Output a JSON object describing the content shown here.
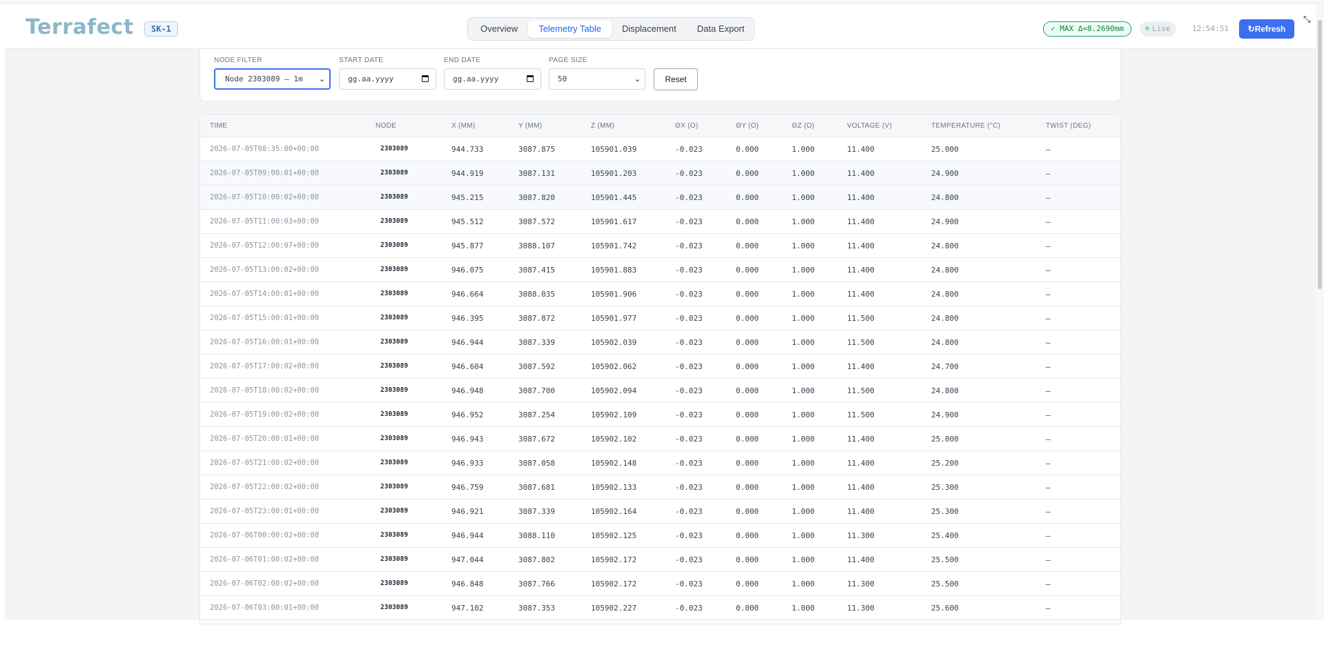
{
  "header": {
    "logo": "Terrafect",
    "site_badge": "SK-1",
    "tabs": [
      "Overview",
      "Telemetry Table",
      "Displacement",
      "Data Export"
    ],
    "active_tab": "Telemetry Table",
    "max_badge": "✓ MAX Δ=8.2690mm",
    "live": "Live",
    "clock": "12:54:51",
    "refresh_label": "Refresh",
    "refresh_icon": "↻"
  },
  "filters": {
    "node_label": "NODE FILTER",
    "node_value": "Node 2303089 — 1m",
    "start_label": "START DATE",
    "start_placeholder": "gg.aa.yyyy",
    "end_label": "END DATE",
    "end_placeholder": "gg.aa.yyyy",
    "page_size_label": "PAGE SIZE",
    "page_size_value": "50",
    "reset_label": "Reset"
  },
  "table": {
    "columns": [
      "TIME",
      "NODE",
      "X (MM)",
      "Y (MM)",
      "Z (MM)",
      "ΘX (Ο)",
      "ΘY (Ο)",
      "ΘZ (Ο)",
      "VOLTAGE (V)",
      "TEMPERATURE (°C)",
      "TWIST (DEG)"
    ],
    "rows": [
      [
        "2026-07-05T08:35:00+00:00",
        "2303089",
        "944.733",
        "3087.875",
        "105901.039",
        "-0.023",
        "0.000",
        "1.000",
        "11.400",
        "25.000",
        "—"
      ],
      [
        "2026-07-05T09:00:01+00:00",
        "2303089",
        "944.919",
        "3087.131",
        "105901.203",
        "-0.023",
        "0.000",
        "1.000",
        "11.400",
        "24.900",
        "—"
      ],
      [
        "2026-07-05T10:00:02+00:00",
        "2303089",
        "945.215",
        "3087.820",
        "105901.445",
        "-0.023",
        "0.000",
        "1.000",
        "11.400",
        "24.800",
        "—"
      ],
      [
        "2026-07-05T11:00:03+00:00",
        "2303089",
        "945.512",
        "3087.572",
        "105901.617",
        "-0.023",
        "0.000",
        "1.000",
        "11.400",
        "24.900",
        "—"
      ],
      [
        "2026-07-05T12:00:07+00:00",
        "2303089",
        "945.877",
        "3088.107",
        "105901.742",
        "-0.023",
        "0.000",
        "1.000",
        "11.400",
        "24.800",
        "—"
      ],
      [
        "2026-07-05T13:00:02+00:00",
        "2303089",
        "946.075",
        "3087.415",
        "105901.883",
        "-0.023",
        "0.000",
        "1.000",
        "11.400",
        "24.800",
        "—"
      ],
      [
        "2026-07-05T14:00:01+00:00",
        "2303089",
        "946.664",
        "3088.035",
        "105901.906",
        "-0.023",
        "0.000",
        "1.000",
        "11.400",
        "24.800",
        "—"
      ],
      [
        "2026-07-05T15:00:01+00:00",
        "2303089",
        "946.395",
        "3087.872",
        "105901.977",
        "-0.023",
        "0.000",
        "1.000",
        "11.500",
        "24.800",
        "—"
      ],
      [
        "2026-07-05T16:00:01+00:00",
        "2303089",
        "946.944",
        "3087.339",
        "105902.039",
        "-0.023",
        "0.000",
        "1.000",
        "11.500",
        "24.800",
        "—"
      ],
      [
        "2026-07-05T17:00:02+00:00",
        "2303089",
        "946.604",
        "3087.592",
        "105902.062",
        "-0.023",
        "0.000",
        "1.000",
        "11.400",
        "24.700",
        "—"
      ],
      [
        "2026-07-05T18:00:02+00:00",
        "2303089",
        "946.948",
        "3087.700",
        "105902.094",
        "-0.023",
        "0.000",
        "1.000",
        "11.500",
        "24.800",
        "—"
      ],
      [
        "2026-07-05T19:00:02+00:00",
        "2303089",
        "946.952",
        "3087.254",
        "105902.109",
        "-0.023",
        "0.000",
        "1.000",
        "11.500",
        "24.900",
        "—"
      ],
      [
        "2026-07-05T20:00:01+00:00",
        "2303089",
        "946.943",
        "3087.672",
        "105902.102",
        "-0.023",
        "0.000",
        "1.000",
        "11.400",
        "25.000",
        "—"
      ],
      [
        "2026-07-05T21:00:02+00:00",
        "2303089",
        "946.933",
        "3087.058",
        "105902.148",
        "-0.023",
        "0.000",
        "1.000",
        "11.400",
        "25.200",
        "—"
      ],
      [
        "2026-07-05T22:00:02+00:00",
        "2303089",
        "946.759",
        "3087.681",
        "105902.133",
        "-0.023",
        "0.000",
        "1.000",
        "11.400",
        "25.300",
        "—"
      ],
      [
        "2026-07-05T23:00:01+00:00",
        "2303089",
        "946.921",
        "3087.339",
        "105902.164",
        "-0.023",
        "0.000",
        "1.000",
        "11.400",
        "25.300",
        "—"
      ],
      [
        "2026-07-06T00:00:02+00:00",
        "2303089",
        "946.944",
        "3088.110",
        "105902.125",
        "-0.023",
        "0.000",
        "1.000",
        "11.300",
        "25.400",
        "—"
      ],
      [
        "2026-07-06T01:00:02+00:00",
        "2303089",
        "947.044",
        "3087.802",
        "105902.172",
        "-0.023",
        "0.000",
        "1.000",
        "11.400",
        "25.500",
        "—"
      ],
      [
        "2026-07-06T02:00:02+00:00",
        "2303089",
        "946.848",
        "3087.766",
        "105902.172",
        "-0.023",
        "0.000",
        "1.000",
        "11.300",
        "25.500",
        "—"
      ],
      [
        "2026-07-06T03:00:01+00:00",
        "2303089",
        "947.102",
        "3087.353",
        "105902.227",
        "-0.023",
        "0.000",
        "1.000",
        "11.300",
        "25.600",
        "—"
      ]
    ]
  }
}
